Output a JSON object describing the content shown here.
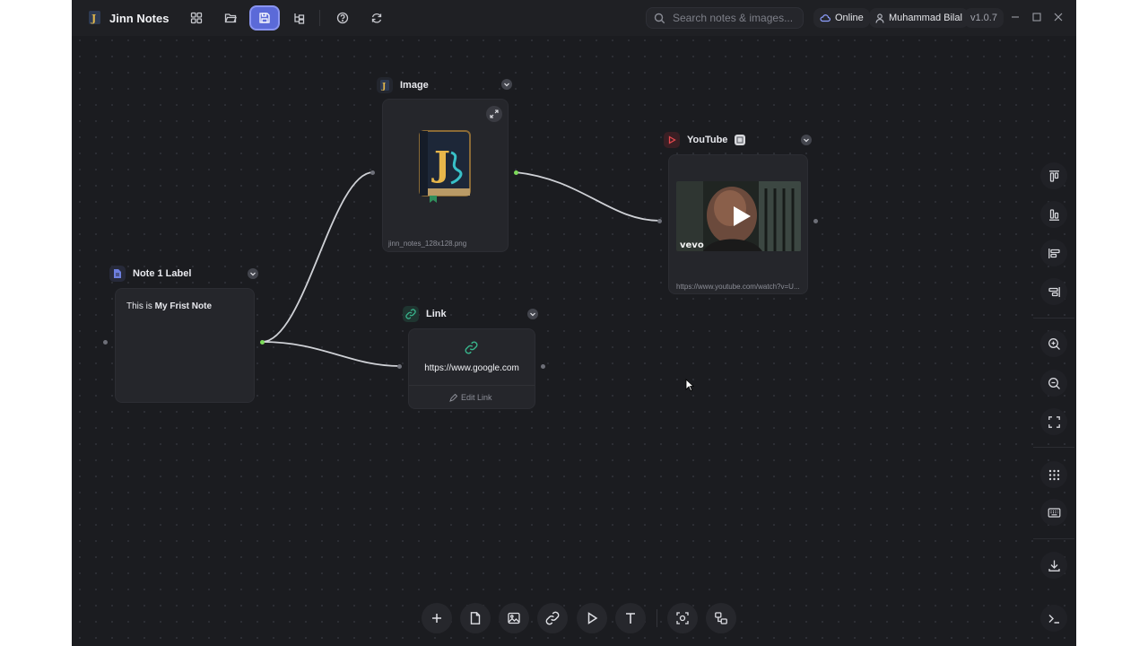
{
  "app": {
    "title": "Jinn Notes",
    "version": "v1.0.7"
  },
  "toolbar": {
    "items": [
      "grid-icon",
      "folder-open-icon",
      "save-icon",
      "tree-icon",
      "help-icon",
      "refresh-icon"
    ]
  },
  "search": {
    "placeholder": "Search notes & images..."
  },
  "status": {
    "label": "Online"
  },
  "user": {
    "name": "Muhammad Bilal"
  },
  "nodes": {
    "image": {
      "title": "Image",
      "filename": "jinn_notes_128x128.png",
      "logo_letter": "J"
    },
    "youtube": {
      "title": "YouTube",
      "url": "https://www.youtube.com/watch?v=U...",
      "watermark": "vevo"
    },
    "note": {
      "title": "Note 1 Label",
      "body_prefix": "This is ",
      "body_bold": "My Frist Note"
    },
    "link": {
      "title": "Link",
      "url": "https://www.google.com",
      "edit_label": "Edit Link"
    }
  },
  "sidebar": {
    "items": [
      "align-top-icon",
      "align-bottom-icon",
      "align-left-icon",
      "align-right-icon",
      "zoom-in-icon",
      "zoom-out-icon",
      "fit-view-icon",
      "grid-dots-icon",
      "keyboard-icon",
      "download-icon",
      "terminal-icon"
    ]
  },
  "bottom_toolbar": {
    "items": [
      "add-icon",
      "note-icon",
      "image-icon",
      "link-icon",
      "play-icon",
      "text-icon",
      "screenshot-icon",
      "arrange-icon"
    ]
  },
  "colors": {
    "accent": "#5b6ad8",
    "canvas": "#1b1c20",
    "node": "#25262b",
    "connection_handle": "#7ddb5a",
    "youtube": "#e5484d",
    "link": "#38b28a"
  }
}
